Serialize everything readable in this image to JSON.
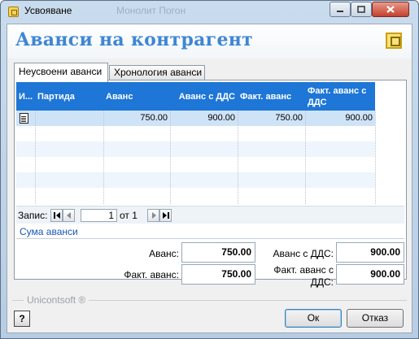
{
  "window": {
    "title": "Усвояване",
    "ghost_title": "Монолит Погон"
  },
  "header": {
    "title": "Аванси на контрагент"
  },
  "tabs": [
    {
      "label": "Неусвоени аванси",
      "active": true
    },
    {
      "label": "Хронология аванси",
      "active": false
    }
  ],
  "grid": {
    "header_color": "#1e76d6",
    "columns": [
      "И...",
      "Партида",
      "Аванс",
      "Аванс с ДДС",
      "Факт. аванс",
      "Факт. аванс с ДДС"
    ],
    "rows": [
      {
        "icon": "document-icon",
        "partida": "",
        "avans": "750.00",
        "avans_dds": "900.00",
        "fakt_avans": "750.00",
        "fakt_avans_dds": "900.00"
      }
    ]
  },
  "navigator": {
    "label": "Запис:",
    "current": "1",
    "of_text": "от 1"
  },
  "summary": {
    "link": "Сума аванси",
    "avans_label": "Аванс:",
    "avans_value": "750.00",
    "avans_dds_label": "Аванс с ДДС:",
    "avans_dds_value": "900.00",
    "fakt_label": "Факт. аванс:",
    "fakt_value": "750.00",
    "fakt_dds_label": "Факт. аванс с ДДС:",
    "fakt_dds_value": "900.00"
  },
  "footer": {
    "brand": "Unicontsoft ®",
    "help": "?",
    "ok": "Ок",
    "cancel": "Отказ"
  }
}
